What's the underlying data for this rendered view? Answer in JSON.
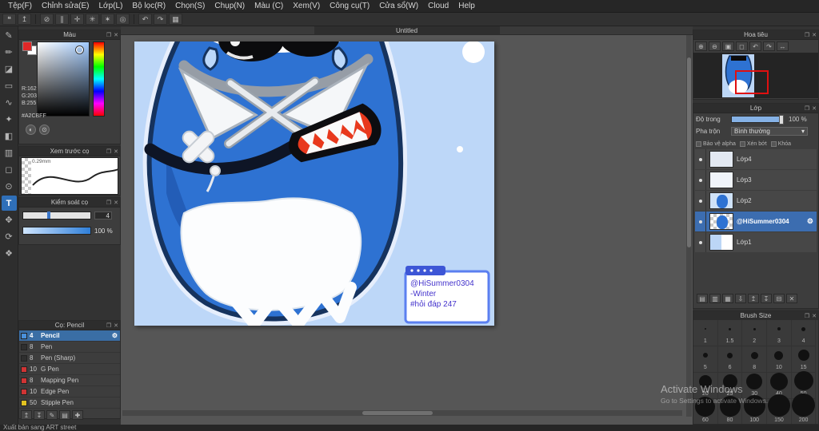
{
  "colors": {
    "selection_accent": "#3c6db0",
    "canvas_background": "#bdd7f8",
    "picked_color": "#A2CBFF",
    "character_blue": "#2e72d2",
    "sign_border_blue": "#5b7ff0",
    "navigator_view_rect": "#e01010"
  },
  "ui": {
    "close": "✕",
    "undock": "❐",
    "caret": "▾",
    "gear": "⚙"
  },
  "menu": {
    "items": [
      "Tệp(F)",
      "Chỉnh sửa(E)",
      "Lớp(L)",
      "Bộ lọc(R)",
      "Chọn(S)",
      "Chụp(N)",
      "Màu (C)",
      "Xem(V)",
      "Công cụ(T)",
      "Cửa sổ(W)",
      "Cloud",
      "Help"
    ]
  },
  "toolbar": {
    "buttons": [
      {
        "glyph": "❝"
      },
      {
        "glyph": "↥"
      },
      {
        "glyph": "⊘"
      },
      {
        "glyph": "∥"
      },
      {
        "glyph": "✛"
      },
      {
        "glyph": "✳"
      },
      {
        "glyph": "✶"
      },
      {
        "glyph": "◎"
      },
      {
        "glyph": "↶"
      },
      {
        "glyph": "↷"
      },
      {
        "glyph": "▦"
      }
    ]
  },
  "tools": {
    "items": [
      {
        "glyph": "✎"
      },
      {
        "glyph": "✏"
      },
      {
        "glyph": "◪"
      },
      {
        "glyph": "▭"
      },
      {
        "glyph": "∿"
      },
      {
        "glyph": "✦"
      },
      {
        "glyph": "◧"
      },
      {
        "glyph": "▥"
      },
      {
        "glyph": "◻"
      },
      {
        "glyph": "⊙"
      },
      {
        "glyph": "T"
      },
      {
        "glyph": "✥"
      },
      {
        "glyph": "⟳"
      },
      {
        "glyph": "❖"
      }
    ]
  },
  "color_panel": {
    "title": "Màu",
    "r": "R:162",
    "g": "G:203",
    "b": "B:255",
    "hex": "#A2CBFF"
  },
  "brush_preview": {
    "title": "Xem trước cọ",
    "stroke_width": "0.29mm"
  },
  "brush_control": {
    "title": "Kiểm soát cọ",
    "size_value": "4",
    "opacity_value": "100 %"
  },
  "brush_panel": {
    "title": "Cọ: Pencil",
    "brushes": [
      {
        "size": "4",
        "name": "Pencil",
        "swatch": "#4a90d9"
      },
      {
        "size": "8",
        "name": "Pen",
        "swatch": "#2f2f2f"
      },
      {
        "size": "8",
        "name": "Pen (Sharp)",
        "swatch": "#2f2f2f"
      },
      {
        "size": "10",
        "name": "G Pen",
        "swatch": "#d03434"
      },
      {
        "size": "8",
        "name": "Mapping Pen",
        "swatch": "#d03434"
      },
      {
        "size": "10",
        "name": "Edge Pen",
        "swatch": "#d03434"
      },
      {
        "size": "50",
        "name": "Stipple Pen",
        "swatch": "#e3c321"
      }
    ],
    "actions": [
      {
        "glyph": "↥"
      },
      {
        "glyph": "↧"
      },
      {
        "glyph": "✎"
      },
      {
        "glyph": "▤"
      },
      {
        "glyph": "✚"
      }
    ]
  },
  "canvas": {
    "tab_title": "Untitled",
    "sign": {
      "line1": "@HiSummer0304",
      "line2": "-Winter",
      "line3": "#hỏi đáp 247"
    }
  },
  "navigator": {
    "title": "Hoa tiêu",
    "tools": [
      {
        "glyph": "⊕"
      },
      {
        "glyph": "⊖"
      },
      {
        "glyph": "▣"
      },
      {
        "glyph": "◻"
      },
      {
        "glyph": "↶"
      },
      {
        "glyph": "↷"
      },
      {
        "glyph": "↔"
      }
    ]
  },
  "layer_panel": {
    "title": "Lớp",
    "opacity_label": "Độ trong",
    "opacity_value": "100 %",
    "blend_label": "Pha trộn",
    "blend_value": "Bình thường",
    "opts": [
      "Bảo vệ alpha",
      "Xén bớt",
      "Khóa"
    ],
    "layers": [
      {
        "name": "Lớp4"
      },
      {
        "name": "Lớp3"
      },
      {
        "name": "Lớp2"
      },
      {
        "name": "@HiSummer0304"
      },
      {
        "name": "Lớp1"
      }
    ],
    "actions": [
      {
        "glyph": "▤"
      },
      {
        "glyph": "▥"
      },
      {
        "glyph": "▦"
      },
      {
        "glyph": "⇩"
      },
      {
        "glyph": "↥"
      },
      {
        "glyph": "↧"
      },
      {
        "glyph": "⊟"
      },
      {
        "glyph": "✕"
      }
    ]
  },
  "brush_size": {
    "title": "Brush Size",
    "sizes": [
      "1",
      "1.5",
      "2",
      "3",
      "4",
      "5",
      "6",
      "8",
      "10",
      "15",
      "20",
      "25",
      "30",
      "40",
      "50",
      "60",
      "80",
      "100",
      "150",
      "200"
    ]
  },
  "status": {
    "text": "Xuất bản sang ART street"
  },
  "watermark": {
    "line1": "Activate Windows",
    "line2": "Go to Settings to activate Windows."
  }
}
